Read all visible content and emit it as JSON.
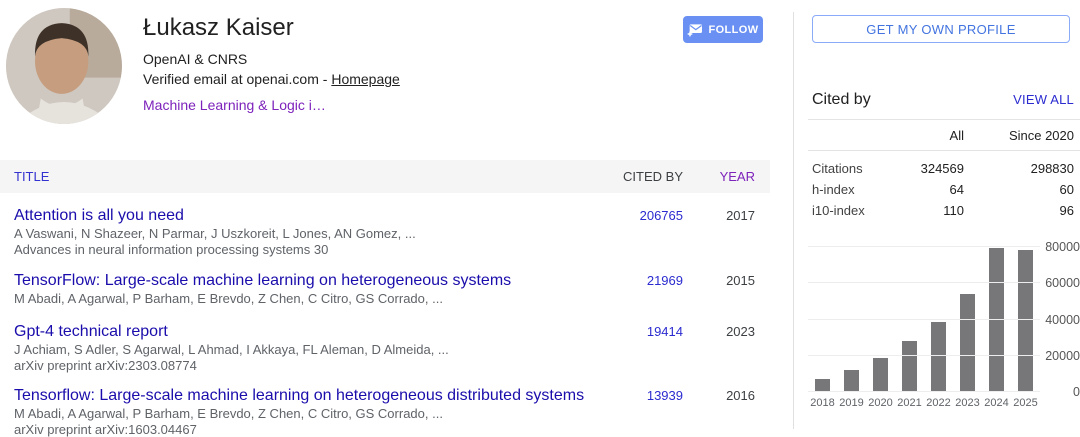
{
  "profile": {
    "name": "Łukasz Kaiser",
    "affiliation": "OpenAI & CNRS",
    "email_line": "Verified email at openai.com - ",
    "homepage_label": "Homepage",
    "interests": "Machine Learning & Logic i…",
    "follow_label": "FOLLOW"
  },
  "buttons": {
    "get_profile": "GET MY OWN PROFILE"
  },
  "table": {
    "headers": {
      "title": "TITLE",
      "cited_by": "CITED BY",
      "year": "YEAR"
    },
    "publications": [
      {
        "title": "Attention is all you need",
        "authors": "A Vaswani, N Shazeer, N Parmar, J Uszkoreit, L Jones, AN Gomez, ...",
        "venue": "Advances in neural information processing systems 30",
        "cited_by": "206765",
        "year": "2017"
      },
      {
        "title": "TensorFlow: Large-scale machine learning on heterogeneous systems",
        "authors": "M Abadi, A Agarwal, P Barham, E Brevdo, Z Chen, C Citro, GS Corrado, ...",
        "venue": "",
        "cited_by": "21969",
        "year": "2015"
      },
      {
        "title": "Gpt-4 technical report",
        "authors": "J Achiam, S Adler, S Agarwal, L Ahmad, I Akkaya, FL Aleman, D Almeida, ...",
        "venue": "arXiv preprint arXiv:2303.08774",
        "cited_by": "19414",
        "year": "2023"
      },
      {
        "title": "Tensorflow: Large-scale machine learning on heterogeneous distributed systems",
        "authors": "M Abadi, A Agarwal, P Barham, E Brevdo, Z Chen, C Citro, GS Corrado, ...",
        "venue": "arXiv preprint arXiv:1603.04467",
        "cited_by": "13939",
        "year": "2016"
      }
    ]
  },
  "cited_by_panel": {
    "title": "Cited by",
    "view_all": "VIEW ALL",
    "columns": [
      "All",
      "Since 2020"
    ],
    "rows": [
      {
        "label": "Citations",
        "all": "324569",
        "since": "298830"
      },
      {
        "label": "h-index",
        "all": "64",
        "since": "60"
      },
      {
        "label": "i10-index",
        "all": "110",
        "since": "96"
      }
    ]
  },
  "chart_data": {
    "type": "bar",
    "title": "",
    "categories": [
      "2018",
      "2019",
      "2020",
      "2021",
      "2022",
      "2023",
      "2024",
      "2025"
    ],
    "values": [
      7200,
      12100,
      18800,
      28100,
      38600,
      54000,
      79500,
      78600
    ],
    "xlabel": "",
    "ylabel": "",
    "ylim": [
      0,
      80000
    ],
    "yticks": [
      0,
      20000,
      40000,
      60000,
      80000
    ],
    "grid": true,
    "bar_color": "#777779",
    "ytick_side": "right"
  },
  "colors": {
    "link_blue": "#1a0dab",
    "indigo_link": "#2b2bd0",
    "visited_purple": "#7d22bb",
    "follow_button": "#6990f2",
    "profile_button_text": "#4374e0",
    "profile_button_border": "#8aabf8",
    "muted_text": "#5f6368",
    "bar_gray": "#777779",
    "header_band": "#f5f5f5"
  }
}
